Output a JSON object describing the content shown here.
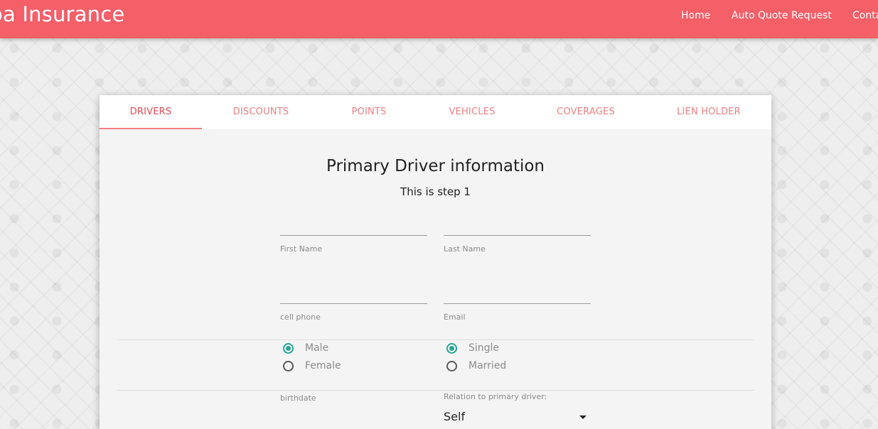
{
  "header": {
    "brand": "oa Insurance",
    "nav": [
      "Home",
      "Auto Quote Request",
      "Conta"
    ],
    "color": "#f45f68"
  },
  "tabs": [
    "DRIVERS",
    "DISCOUNTS",
    "POINTS",
    "VEHICLES",
    "COVERAGES",
    "LIEN HOLDER"
  ],
  "active_tab": "DRIVERS",
  "form": {
    "title": "Primary Driver information",
    "subtitle": "This is step 1",
    "first_name": {
      "label": "First Name",
      "value": ""
    },
    "last_name": {
      "label": "Last Name",
      "value": ""
    },
    "cell_phone": {
      "label": "cell phone",
      "value": ""
    },
    "email": {
      "label": "Email",
      "value": ""
    },
    "gender": {
      "options": [
        "Male",
        "Female"
      ],
      "selected": "Male"
    },
    "marital": {
      "options": [
        "Single",
        "Married"
      ],
      "selected": "Single"
    },
    "birthdate_label": "birthdate",
    "relation": {
      "label": "Relation to primary driver:",
      "value": "Self"
    },
    "accent_color": "#26a69a"
  }
}
